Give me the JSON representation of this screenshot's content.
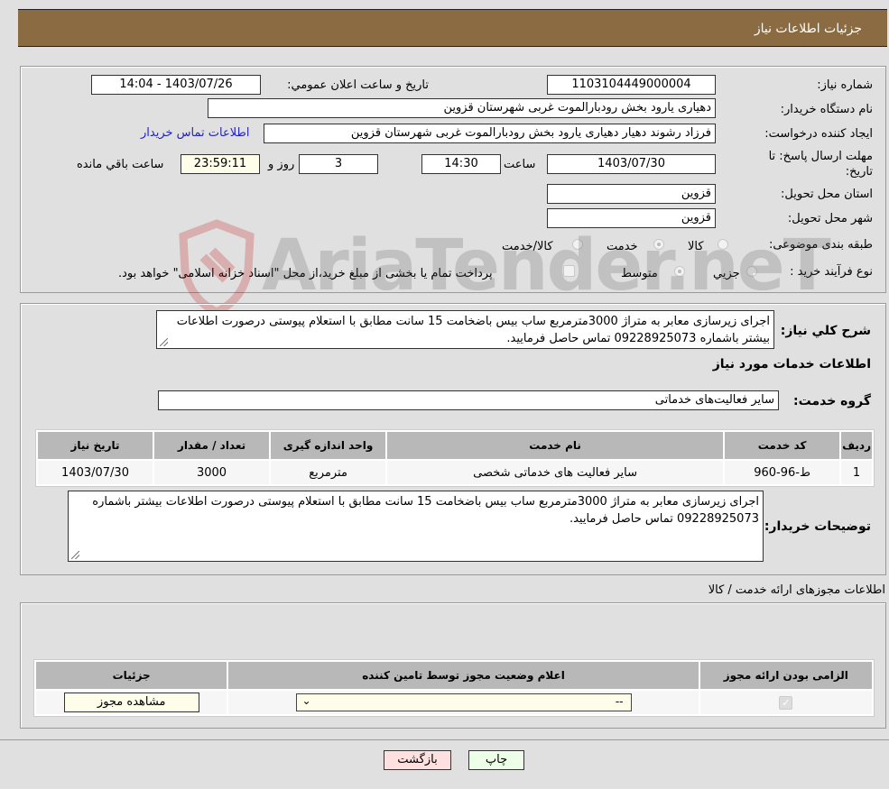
{
  "header": {
    "title": "جزئیات اطلاعات نیاز"
  },
  "need_info": {
    "need_number_label": "شماره نیاز:",
    "need_number": "1103104449000004",
    "announce_label": "تاریخ و ساعت اعلان عمومي:",
    "announce_value": "1403/07/26 - 14:04",
    "buyer_org_label": "نام دستگاه خریدار:",
    "buyer_org": "دهیاری یارود بخش رودبارالموت غربی شهرستان قزوین",
    "creator_label": "ایجاد کننده درخواست:",
    "creator": "فرزاد رشوند دهیار دهیاری یارود بخش رودبارالموت غربی شهرستان قزوین",
    "buyer_contact_link": "اطلاعات تماس خریدار",
    "deadline_label": "مهلت ارسال پاسخ: تا تاریخ:",
    "deadline_date": "1403/07/30",
    "time_label": "ساعت",
    "deadline_time": "14:30",
    "days_value": "3",
    "days_label": "روز و",
    "remaining_time": "23:59:11",
    "remaining_label": "ساعت باقي مانده",
    "province_label": "استان محل تحویل:",
    "province": "قزوین",
    "city_label": "شهر محل تحویل:",
    "city": "قزوین",
    "category_label": "طبقه بندی موضوعی:",
    "category_options": [
      "کالا",
      "خدمت",
      "کالا/خدمت"
    ],
    "category_selected": "خدمت",
    "process_label": "نوع فرآیند خرید :",
    "process_options": [
      "جزيي",
      "متوسط"
    ],
    "process_selected": "متوسط",
    "treasury_note": "پرداخت تمام یا بخشی از مبلغ خرید،از محل \"اسناد خزانه اسلامی\" خواهد بود."
  },
  "description": {
    "label": "شرح کلي نیاز:",
    "text": "اجرای زیرسازی معابر به متراژ 3000مترمربع ساب بیس باضخامت 15 سانت مطابق با استعلام پیوستی درصورت اطلاعات بیشتر باشماره 09228925073 تماس حاصل فرمایید.",
    "services_heading": "اطلاعات خدمات مورد نیاز",
    "service_group_label": "گروه خدمت:",
    "service_group": "سایر فعالیت‌های خدماتی"
  },
  "services_table": {
    "headers": [
      "ردیف",
      "کد خدمت",
      "نام خدمت",
      "واحد اندازه گیری",
      "تعداد / مقدار",
      "تاریخ نیاز"
    ],
    "rows": [
      [
        "1",
        "ط-96-960",
        "سایر فعالیت های خدماتی شخصی",
        "مترمربع",
        "3000",
        "1403/07/30"
      ]
    ]
  },
  "buyer_notes": {
    "label": "توضیحات خریدار:",
    "text": "اجرای زیرسازی معابر به متراژ 3000مترمربع ساب بیس باضخامت 15 سانت مطابق با استعلام پیوستی درصورت اطلاعات بیشتر باشماره 09228925073 تماس حاصل فرمایید."
  },
  "permits": {
    "heading": "اطلاعات مجوزهای ارائه خدمت / کالا",
    "headers": [
      "الزامی بودن ارائه مجوز",
      "اعلام وضعیت مجوز توسط تامین کننده",
      "جزئیات"
    ],
    "row": {
      "required_checked": true,
      "status_value": "--",
      "details_button": "مشاهده مجوز"
    }
  },
  "footer": {
    "print_button": "چاپ",
    "back_button": "بازگشت"
  },
  "watermark": {
    "text": "AriaTender.neT"
  }
}
